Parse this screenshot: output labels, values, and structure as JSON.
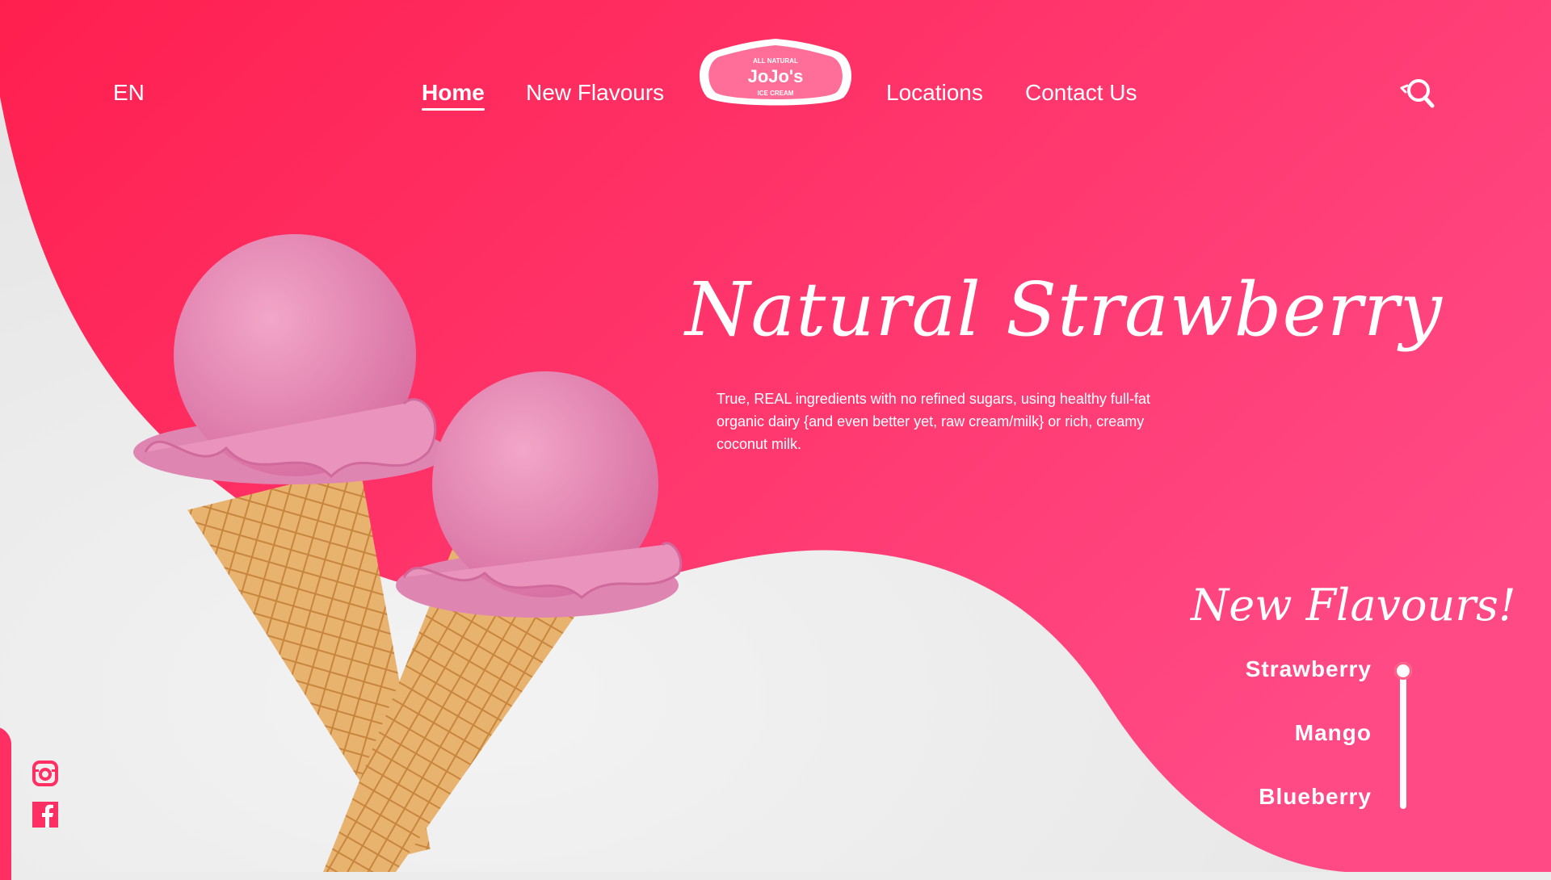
{
  "header": {
    "language": "EN",
    "nav_left": [
      {
        "label": "Home",
        "active": true
      },
      {
        "label": "New Flavours",
        "active": false
      }
    ],
    "nav_right": [
      {
        "label": "Locations"
      },
      {
        "label": "Contact Us"
      }
    ],
    "logo": {
      "top_text": "ALL NATURAL",
      "main_text": "JoJo's",
      "bottom_text": "ICE CREAM"
    },
    "search_icon": "search-icon"
  },
  "hero": {
    "title": "Natural Strawberry",
    "description": "True, REAL ingredients with no refined sugars, using healthy full-fat organic dairy {and even better yet, raw cream/milk} or rich, creamy coconut milk."
  },
  "new_flavours": {
    "title": "New Flavours!",
    "items": [
      "Strawberry",
      "Mango",
      "Blueberry"
    ],
    "selected": "Strawberry"
  },
  "social": {
    "icons": [
      "instagram-icon",
      "facebook-icon"
    ]
  },
  "colors": {
    "accent": "#ff2e63",
    "accent_light": "#ff4f86",
    "white": "#ffffff",
    "background": "#ececec"
  }
}
